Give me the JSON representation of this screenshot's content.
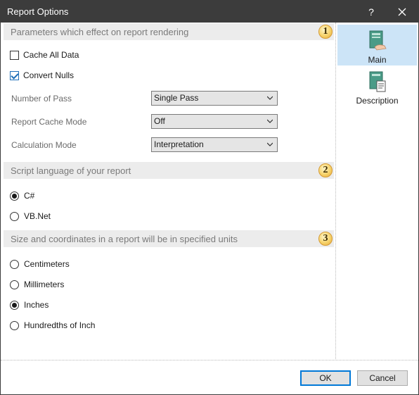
{
  "window": {
    "title": "Report Options",
    "help_label": "?",
    "close_label": "✕"
  },
  "sections": {
    "rendering": {
      "header": "Parameters which effect on report rendering",
      "badge": "1",
      "cache_all_data": {
        "label": "Cache All Data",
        "checked": false
      },
      "convert_nulls": {
        "label": "Convert Nulls",
        "checked": true
      },
      "number_of_pass": {
        "label": "Number of Pass",
        "value": "Single Pass"
      },
      "report_cache_mode": {
        "label": "Report Cache Mode",
        "value": "Off"
      },
      "calculation_mode": {
        "label": "Calculation Mode",
        "value": "Interpretation"
      }
    },
    "script": {
      "header": "Script language of your report",
      "badge": "2",
      "options": [
        {
          "label": "C#",
          "checked": true
        },
        {
          "label": "VB.Net",
          "checked": false
        }
      ]
    },
    "units": {
      "header": "Size and coordinates in a report will be in specified units",
      "badge": "3",
      "options": [
        {
          "label": "Centimeters",
          "checked": false
        },
        {
          "label": "Millimeters",
          "checked": false
        },
        {
          "label": "Inches",
          "checked": true
        },
        {
          "label": "Hundredths of Inch",
          "checked": false
        }
      ]
    }
  },
  "sidebar": {
    "items": [
      {
        "label": "Main",
        "icon": "main-page-icon",
        "active": true
      },
      {
        "label": "Description",
        "icon": "description-page-icon",
        "active": false
      }
    ]
  },
  "footer": {
    "ok_label": "OK",
    "cancel_label": "Cancel"
  },
  "colors": {
    "titlebar": "#3c3c3c",
    "section_header_bg": "#ececec",
    "sidebar_active": "#cce4f7",
    "accent": "#0078d7"
  }
}
